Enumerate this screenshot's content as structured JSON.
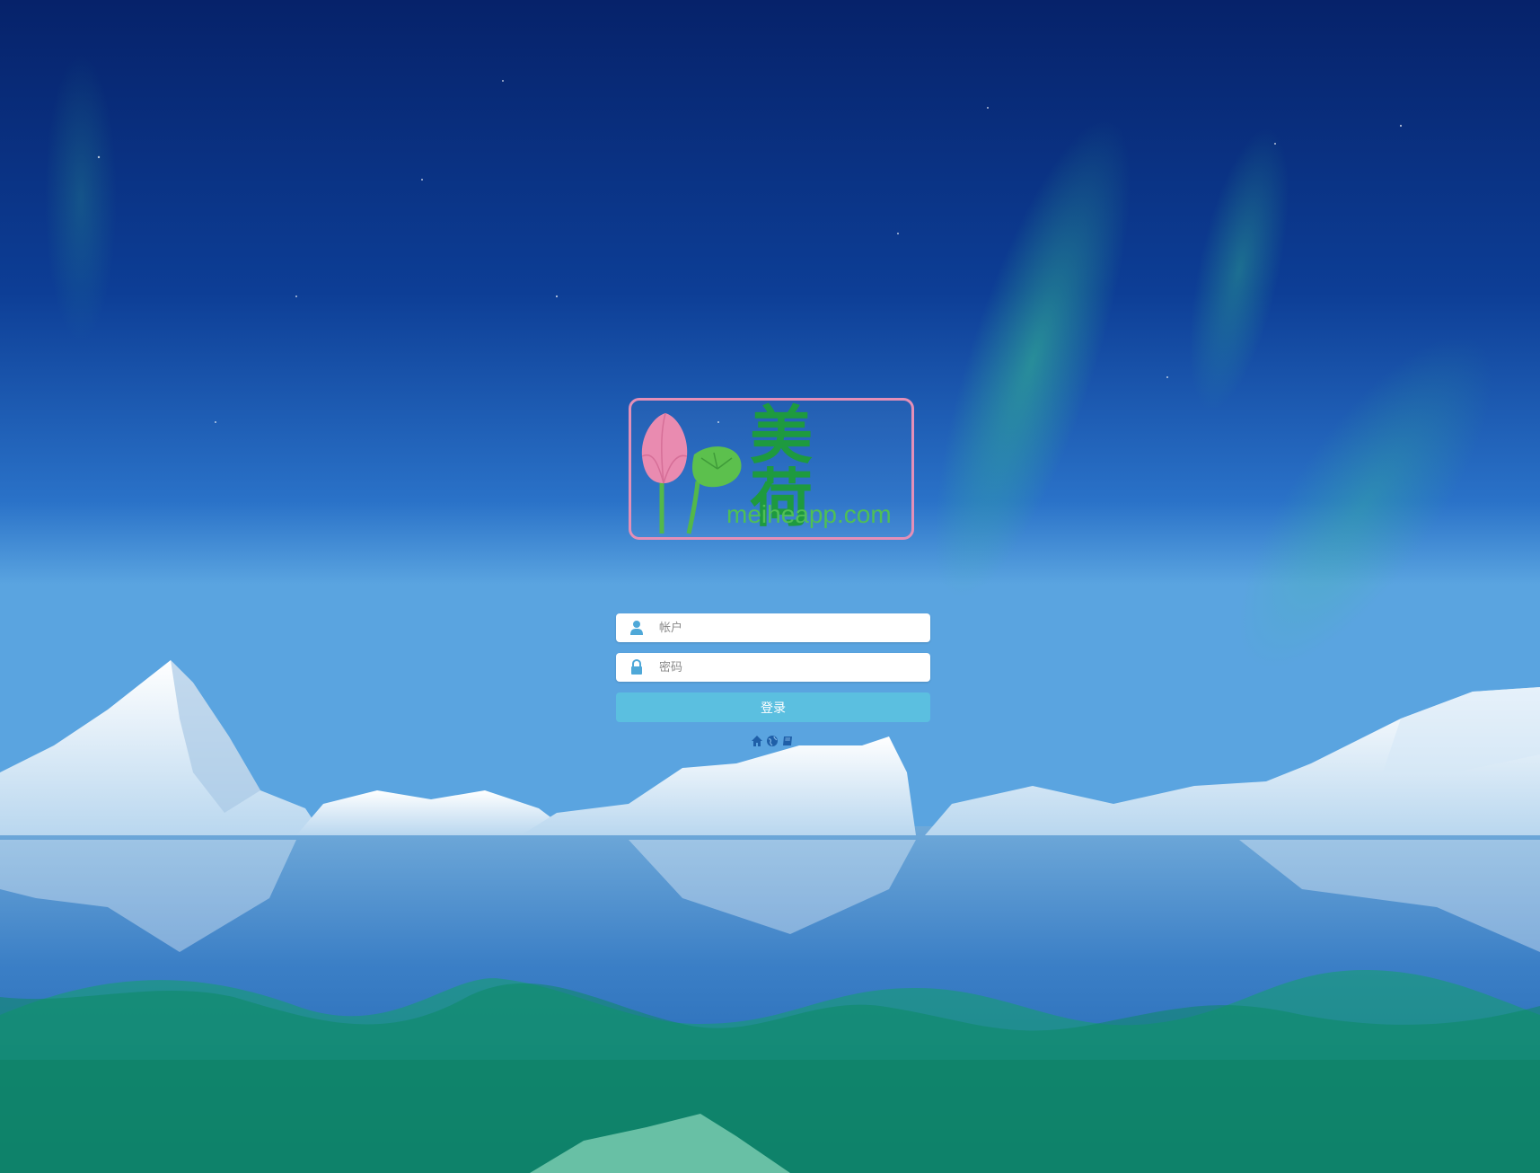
{
  "logo": {
    "chinese_text": "美 荷",
    "domain_text": "meiheapp.com"
  },
  "login": {
    "account_placeholder": "帐户",
    "password_placeholder": "密码",
    "submit_label": "登录"
  },
  "footer_links": [
    {
      "icon": "home-icon"
    },
    {
      "icon": "globe-icon"
    },
    {
      "icon": "book-icon"
    }
  ],
  "colors": {
    "sky_top": "#06246b",
    "sky_mid": "#1a56b5",
    "aurora": "#2fb38a",
    "wave": "#0f8a6a",
    "logo_border": "#e48fb7",
    "logo_text": "#1e9a3f",
    "button": "#5bbfe0",
    "icon_blue": "#4fa8d8"
  }
}
